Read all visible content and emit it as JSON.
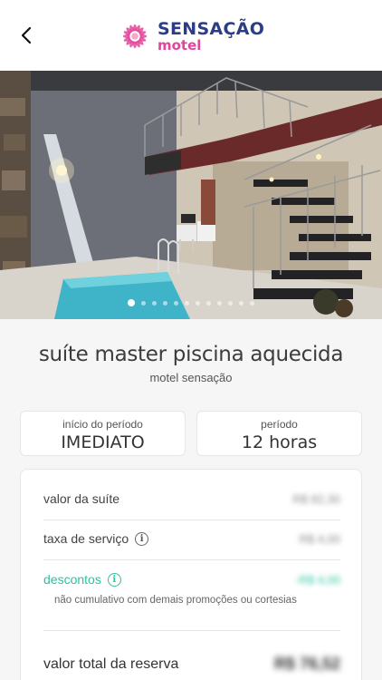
{
  "header": {
    "brand_name": "SENSAÇÃO",
    "brand_sub": "motel"
  },
  "icons": {
    "back": "chevron-left-icon",
    "info": "info-icon",
    "logo": "flower-logo-icon"
  },
  "colors": {
    "brand_blue": "#2b3d85",
    "brand_pink": "#e2469a",
    "discount_green": "#2cc39e"
  },
  "gallery": {
    "image_count": 12,
    "active_index": 0
  },
  "suite": {
    "title": "suíte master piscina aquecida",
    "motel": "motel sensação"
  },
  "booking": {
    "start_label": "início do período",
    "start_value": "IMEDIATO",
    "period_label": "período",
    "period_value": "12 horas"
  },
  "pricing": {
    "suite_value_label": "valor da suíte",
    "suite_value": "R$ 82,30",
    "service_fee_label": "taxa de serviço",
    "service_fee": "R$ 4,00",
    "discounts_label": "descontos",
    "discounts": "-R$ 4,00",
    "discount_note": "não cumulativo com demais promoções ou cortesias",
    "total_label": "valor total da reserva",
    "total": "R$ 76,52"
  }
}
